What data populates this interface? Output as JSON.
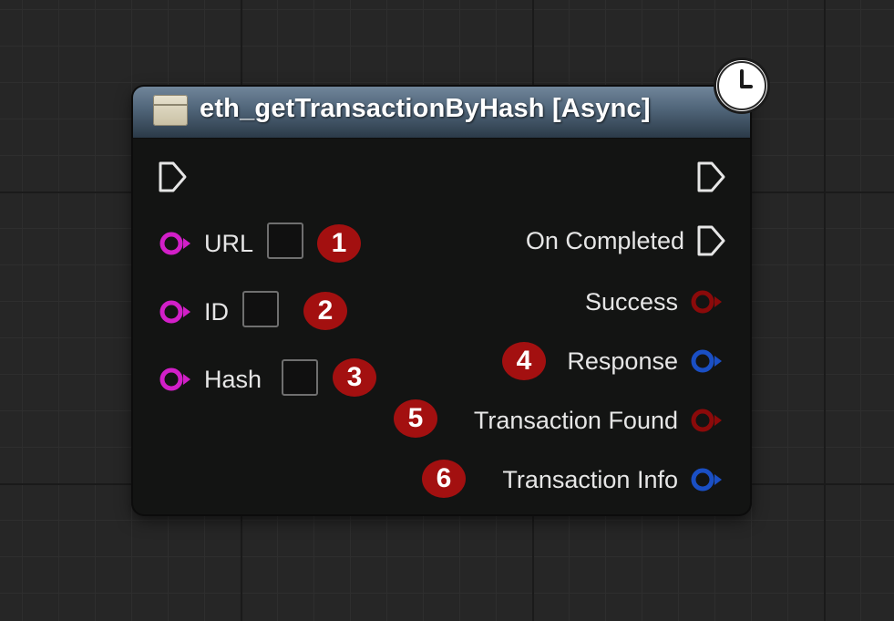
{
  "node": {
    "title": "eth_getTransactionByHash [Async]",
    "icon": "function-icon",
    "badge": "clock-icon",
    "header_colors": [
      "#70859a",
      "#2b3a48"
    ]
  },
  "inputs": [
    {
      "label": "URL",
      "marker": "1",
      "pin_color": "#d21fc8"
    },
    {
      "label": "ID",
      "marker": "2",
      "pin_color": "#d21fc8"
    },
    {
      "label": "Hash",
      "marker": "3",
      "pin_color": "#d21fc8"
    }
  ],
  "outputs": [
    {
      "label": "On Completed",
      "type": "exec"
    },
    {
      "label": "Success",
      "pin_color": "#8b0a0a"
    },
    {
      "label": "Response",
      "marker": "4",
      "pin_color": "#1a4fc4"
    },
    {
      "label": "Transaction Found",
      "marker": "5",
      "pin_color": "#8b0a0a"
    },
    {
      "label": "Transaction Info",
      "marker": "6",
      "pin_color": "#1a4fc4"
    }
  ],
  "colors": {
    "marker": "#a31010",
    "input_pin": "#d21fc8",
    "bool_pin": "#8b0a0a",
    "struct_pin": "#1a4fc4",
    "exec_pin": "#e6e6e6"
  }
}
